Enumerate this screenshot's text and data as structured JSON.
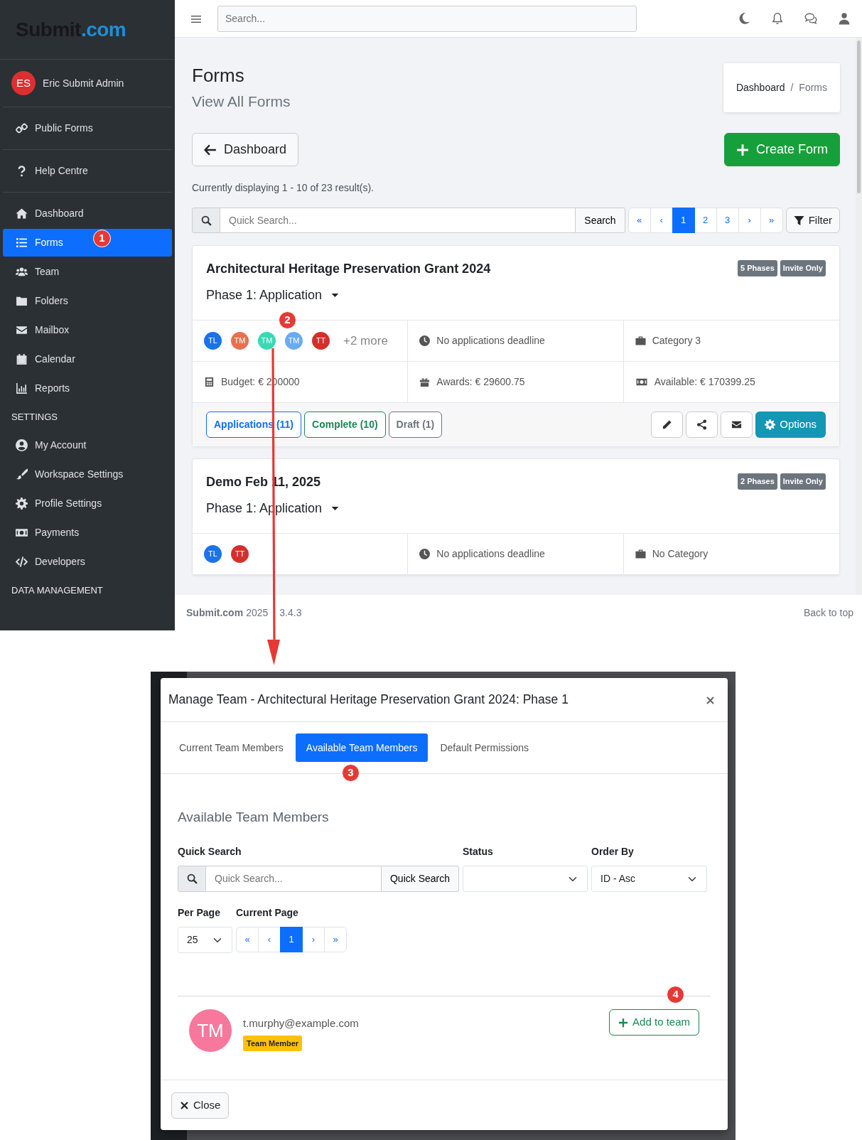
{
  "sidebar": {
    "logo": {
      "main": "Submit",
      "accent": ".com"
    },
    "user": {
      "initials": "ES",
      "name": "Eric Submit Admin"
    },
    "sections": [
      {
        "items": [
          {
            "kind": "link",
            "label": "Public Forms",
            "selected": false
          }
        ]
      },
      {
        "items": [
          {
            "kind": "link",
            "label": "Help Centre",
            "selected": false
          }
        ]
      },
      {
        "items": [
          {
            "kind": "link",
            "label": "Dashboard",
            "selected": false
          },
          {
            "kind": "link",
            "label": "Forms",
            "selected": true,
            "marker": "1"
          },
          {
            "kind": "link",
            "label": "Team",
            "selected": false
          },
          {
            "kind": "link",
            "label": "Folders",
            "selected": false
          },
          {
            "kind": "link",
            "label": "Mailbox",
            "selected": false
          },
          {
            "kind": "link",
            "label": "Calendar",
            "selected": false
          },
          {
            "kind": "link",
            "label": "Reports",
            "selected": false
          },
          {
            "kind": "heading",
            "label": "SETTINGS"
          },
          {
            "kind": "link",
            "label": "My Account",
            "selected": false
          },
          {
            "kind": "link",
            "label": "Workspace Settings",
            "selected": false
          },
          {
            "kind": "link",
            "label": "Profile Settings",
            "selected": false
          },
          {
            "kind": "link",
            "label": "Payments",
            "selected": false
          },
          {
            "kind": "link",
            "label": "Developers",
            "selected": false
          },
          {
            "kind": "heading",
            "label": "DATA MANAGEMENT"
          }
        ]
      }
    ]
  },
  "topbar": {
    "search_placeholder": "Search..."
  },
  "page": {
    "title": "Forms",
    "subtitle": "View All Forms",
    "breadcrumb": [
      {
        "label": "Dashboard",
        "active": false
      },
      {
        "label": "Forms",
        "active": true
      }
    ],
    "breadcrumb_separator": "/",
    "back_button": "Dashboard",
    "create_button": "Create Form",
    "results_text": "Currently displaying 1 - 10 of 23 result(s).",
    "search": {
      "placeholder": "Quick Search...",
      "button": "Search"
    },
    "pagination": [
      {
        "label": "«",
        "selected": false
      },
      {
        "label": "‹",
        "selected": false
      },
      {
        "label": "1",
        "selected": true
      },
      {
        "label": "2",
        "selected": false
      },
      {
        "label": "3",
        "selected": false
      },
      {
        "label": "›",
        "selected": false
      },
      {
        "label": "»",
        "selected": false
      }
    ],
    "filter_button": "Filter"
  },
  "forms": [
    {
      "title": "Architectural Heritage Preservation Grant 2024",
      "badges": [
        "5 Phases",
        "Invite Only"
      ],
      "phase": "Phase 1: Application",
      "marker": "2",
      "team": [
        {
          "initials": "TL",
          "color": "#1a73e8"
        },
        {
          "initials": "TM",
          "color": "#e8704f"
        },
        {
          "initials": "TM",
          "color": "#3ad8b4"
        },
        {
          "initials": "TM",
          "color": "#6aaaf2"
        },
        {
          "initials": "TT",
          "color": "#d3302c"
        }
      ],
      "team_more": "+2 more",
      "cells": [
        "No applications deadline",
        "Category 3",
        "Budget: € 200000",
        "Awards: € 29600.75",
        "Available: € 170399.25"
      ],
      "status_buttons": [
        {
          "label": "Applications (11)",
          "kind": "primary"
        },
        {
          "label": "Complete (10)",
          "kind": "success"
        },
        {
          "label": "Draft (1)",
          "kind": "secondary"
        }
      ],
      "options_button": "Options"
    },
    {
      "title": "Demo Feb 11, 2025",
      "badges": [
        "2 Phases",
        "Invite Only"
      ],
      "phase": "Phase 1: Application",
      "team": [
        {
          "initials": "TL",
          "color": "#1a73e8"
        },
        {
          "initials": "TT",
          "color": "#d3302c"
        }
      ],
      "cells": [
        "No applications deadline",
        "No Category"
      ]
    }
  ],
  "footer": {
    "brand": "Submit.com",
    "year": "2025",
    "version": "3.4.3",
    "back_to_top": "Back to top"
  },
  "modal": {
    "title": "Manage Team - Architectural Heritage Preservation Grant 2024: Phase 1",
    "tabs": [
      {
        "label": "Current Team Members",
        "selected": false
      },
      {
        "label": "Available Team Members",
        "selected": true,
        "marker": "3"
      },
      {
        "label": "Default Permissions",
        "selected": false
      }
    ],
    "heading": "Available Team Members",
    "search_label": "Quick Search",
    "search_placeholder": "Quick Search...",
    "search_button": "Quick Search",
    "status_label": "Status",
    "order_label": "Order By",
    "order_value": "ID - Asc",
    "per_page_label": "Per Page",
    "per_page_value": "25",
    "current_page_label": "Current Page",
    "pages": [
      {
        "label": "«",
        "selected": false
      },
      {
        "label": "‹",
        "selected": false
      },
      {
        "label": "1",
        "selected": true
      },
      {
        "label": "›",
        "selected": false
      },
      {
        "label": "»",
        "selected": false
      }
    ],
    "members": [
      {
        "initials": "TM",
        "color": "#f7789c",
        "email": "t.murphy@example.com",
        "role": "Team Member",
        "add_button": "Add to team",
        "marker": "4"
      }
    ],
    "close_button": "Close"
  }
}
